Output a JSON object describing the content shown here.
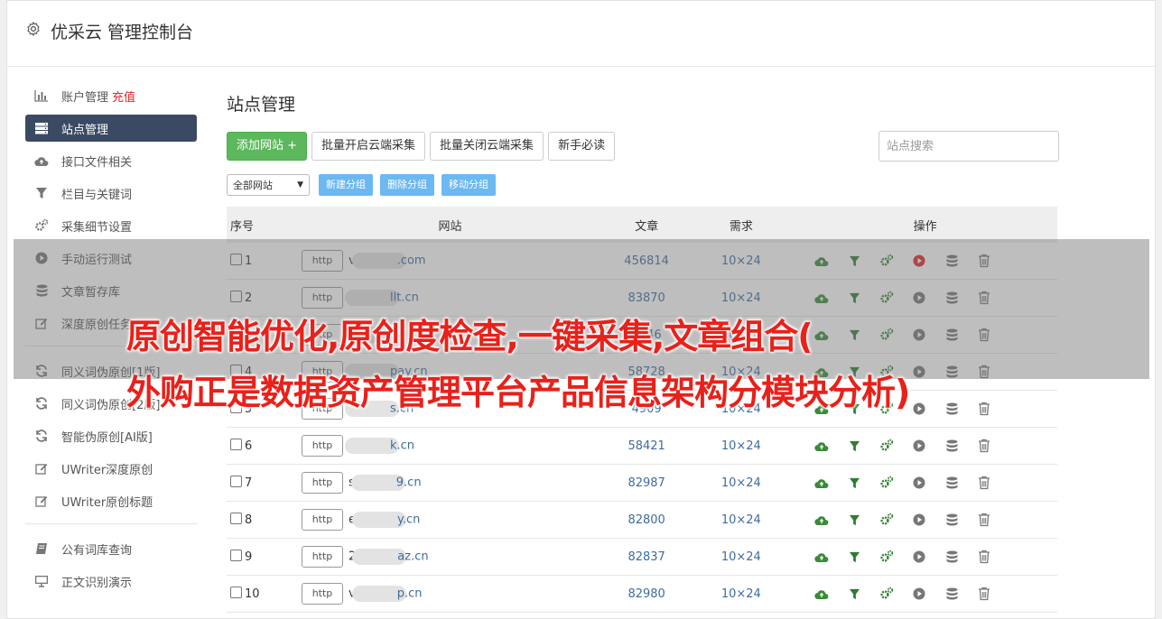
{
  "app": {
    "title": "优采云 管理控制台"
  },
  "sidebar": {
    "items": [
      {
        "label": "账户管理",
        "extra": "充值",
        "icon": "bar-chart-icon"
      },
      {
        "label": "站点管理",
        "icon": "server-icon",
        "active": true
      },
      {
        "label": "接口文件相关",
        "icon": "cloud-upload-icon"
      },
      {
        "label": "栏目与关键词",
        "icon": "filter-icon"
      },
      {
        "label": "采集细节设置",
        "icon": "cogs-icon"
      },
      {
        "label": "手动运行测试",
        "icon": "play-icon"
      },
      {
        "label": "文章暂存库",
        "icon": "database-icon"
      },
      {
        "label": "深度原创任务",
        "icon": "edit-icon"
      },
      {
        "label": "同义词伪原创[1版]",
        "icon": "refresh-icon"
      },
      {
        "label": "同义词伪原创[2版]",
        "icon": "refresh-icon"
      },
      {
        "label": "智能伪原创[AI版]",
        "icon": "refresh-icon"
      },
      {
        "label": "UWriter深度原创",
        "icon": "edit-icon"
      },
      {
        "label": "UWriter原创标题",
        "icon": "edit-icon"
      },
      {
        "label": "公有词库查询",
        "icon": "book-icon"
      },
      {
        "label": "正文识别演示",
        "icon": "monitor-icon"
      }
    ]
  },
  "main": {
    "title": "站点管理",
    "buttons": {
      "add_site": "添加网站 +",
      "batch_open": "批量开启云端采集",
      "batch_close": "批量关闭云端采集",
      "guide": "新手必读"
    },
    "search_placeholder": "站点搜索",
    "group_select": "全部网站",
    "group_buttons": {
      "new": "新建分组",
      "delete": "删除分组",
      "move": "移动分组"
    },
    "table": {
      "headers": {
        "index": "序号",
        "site": "网站",
        "articles": "文章",
        "demand": "需求",
        "ops": "操作"
      },
      "protocol_label": "http",
      "rows": [
        {
          "index": "1",
          "site": "v",
          "site_tail": ".com",
          "articles": "456814",
          "demand": "10×24"
        },
        {
          "index": "2",
          "site": "",
          "site_tail": "llt.cn",
          "articles": "83870",
          "demand": "10×24"
        },
        {
          "index": "3",
          "site": "",
          "site_tail": "",
          "articles": "4346",
          "demand": "10×24"
        },
        {
          "index": "4",
          "site": "",
          "site_tail": "pay.cn",
          "articles": "58728",
          "demand": "10×24"
        },
        {
          "index": "5",
          "site": "",
          "site_tail": "s.cn",
          "articles": "4909",
          "demand": "10×24"
        },
        {
          "index": "6",
          "site": "",
          "site_tail": "k.cn",
          "articles": "58421",
          "demand": "10×24"
        },
        {
          "index": "7",
          "site": "s",
          "site_tail": "9.cn",
          "articles": "82987",
          "demand": "10×24"
        },
        {
          "index": "8",
          "site": "e",
          "site_tail": "y.cn",
          "articles": "82800",
          "demand": "10×24"
        },
        {
          "index": "9",
          "site": "2",
          "site_tail": "az.cn",
          "articles": "82837",
          "demand": "10×24"
        },
        {
          "index": "10",
          "site": "v",
          "site_tail": "p.cn",
          "articles": "82980",
          "demand": "10×24"
        }
      ]
    }
  },
  "banner": {
    "line1": "原创智能优化,原创度检查,一键采集,文章组合(",
    "line2": "外购正是数据资产管理平台产品信息架构分模块分析)"
  },
  "colors": {
    "accent_green": "#5cb85c",
    "active_nav": "#3b4a63",
    "link_blue": "#3d6c9e",
    "banner_red": "#e8211a",
    "run_red": "#e0262b"
  }
}
